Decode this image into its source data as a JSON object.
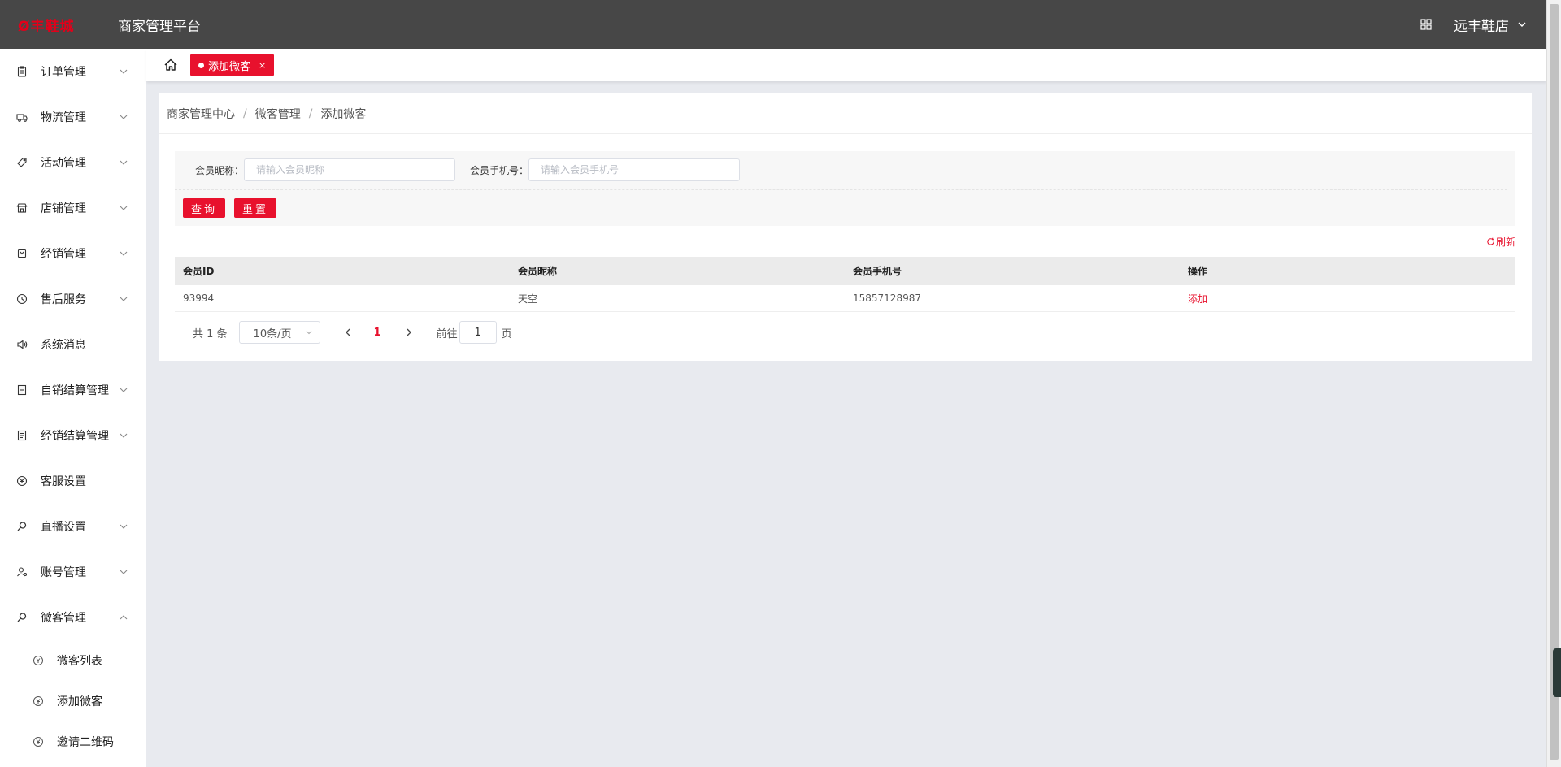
{
  "header": {
    "logo_text": "Ø丰鞋城",
    "platform_title": "商家管理平台",
    "store_name": "远丰鞋店",
    "icons": {
      "grid": "qrcode-grid-icon",
      "dropdown": "chevron-down-icon"
    }
  },
  "sidebar": {
    "items": [
      {
        "label": "订单管理",
        "icon": "clipboard-icon",
        "expandable": true
      },
      {
        "label": "物流管理",
        "icon": "truck-icon",
        "expandable": true
      },
      {
        "label": "活动管理",
        "icon": "tag-icon",
        "expandable": true
      },
      {
        "label": "店铺管理",
        "icon": "shop-icon",
        "expandable": true
      },
      {
        "label": "经销管理",
        "icon": "bag-icon",
        "expandable": true
      },
      {
        "label": "售后服务",
        "icon": "clock-icon",
        "expandable": true
      },
      {
        "label": "系统消息",
        "icon": "speaker-icon",
        "expandable": false
      },
      {
        "label": "自销结算管理",
        "icon": "document-icon",
        "expandable": true
      },
      {
        "label": "经销结算管理",
        "icon": "document-icon",
        "expandable": true
      },
      {
        "label": "客服设置",
        "icon": "coin-icon",
        "expandable": false
      },
      {
        "label": "直播设置",
        "icon": "search-icon",
        "expandable": true
      },
      {
        "label": "账号管理",
        "icon": "user-icon",
        "expandable": true
      },
      {
        "label": "微客管理",
        "icon": "search-icon",
        "expandable": true,
        "expanded": true
      }
    ],
    "sub_items": [
      {
        "label": "微客列表",
        "icon": "coin-icon"
      },
      {
        "label": "添加微客",
        "icon": "coin-icon"
      },
      {
        "label": "邀请二维码",
        "icon": "coin-icon"
      }
    ]
  },
  "tabs": {
    "home_icon": "home-icon",
    "active_label": "添加微客",
    "close_glyph": "×"
  },
  "breadcrumb": [
    "商家管理中心",
    "微客管理",
    "添加微客"
  ],
  "breadcrumb_sep": "/",
  "filter": {
    "nickname_label": "会员昵称：",
    "nickname_placeholder": "请输入会员昵称",
    "nickname_value": "",
    "phone_label": "会员手机号：",
    "phone_placeholder": "请输入会员手机号",
    "phone_value": "",
    "search_button": "查询",
    "reset_button": "重置"
  },
  "refresh_label": "刷新",
  "table": {
    "columns": [
      "会员ID",
      "会员昵称",
      "会员手机号",
      "操作"
    ],
    "rows": [
      {
        "id": "93994",
        "nickname": "天空",
        "phone": "15857128987",
        "action": "添加"
      }
    ]
  },
  "pagination": {
    "total_text": "共 1 条",
    "page_size": "10条/页",
    "current_page": "1",
    "goto_label": "前往",
    "goto_value": "1",
    "page_unit": "页"
  },
  "colors": {
    "accent": "#e8112d",
    "topbar": "#474747",
    "background": "#e8eaef"
  }
}
